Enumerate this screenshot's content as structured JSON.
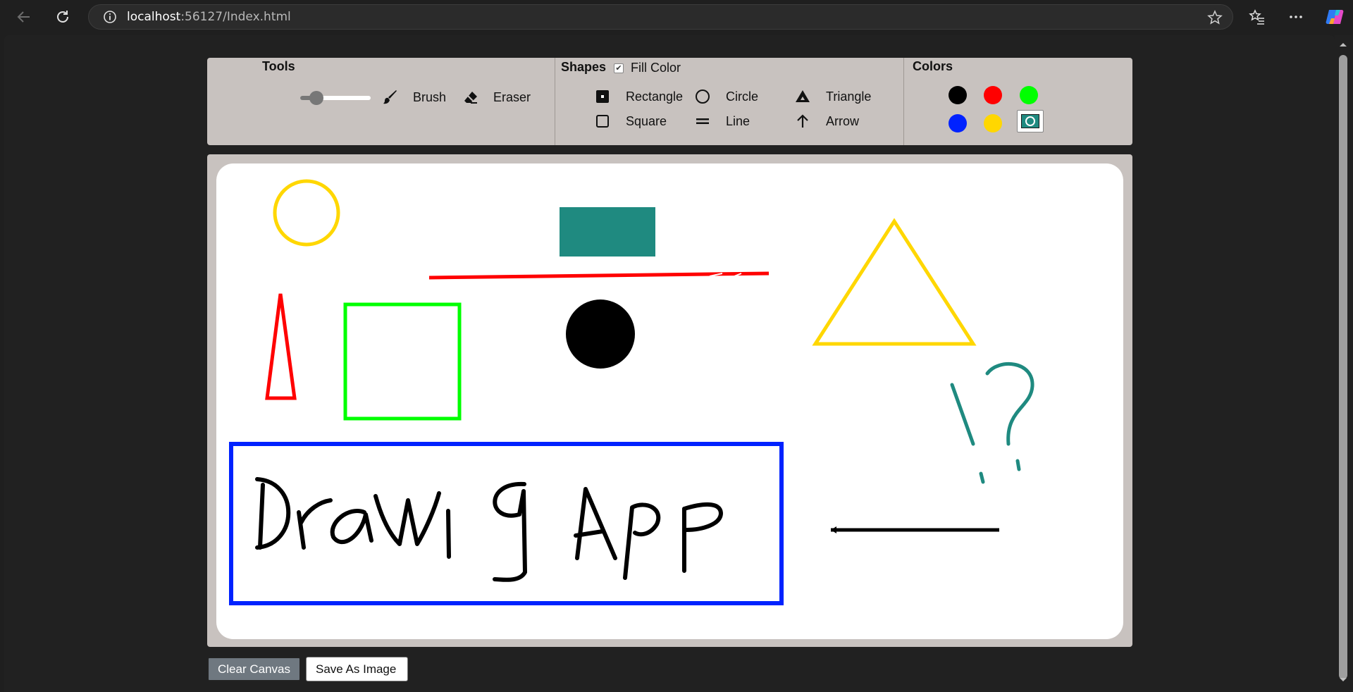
{
  "browser": {
    "url_host": "localhost",
    "url_rest": ":56127/Index.html"
  },
  "toolbar": {
    "tools": {
      "title": "Tools",
      "brush_size": 0.2,
      "brush_label": "Brush",
      "eraser_label": "Eraser"
    },
    "shapes": {
      "title": "Shapes",
      "fill_color_label": "Fill Color",
      "fill_color_checked": true,
      "items": [
        {
          "label": "Rectangle",
          "icon": "filled-square-icon"
        },
        {
          "label": "Circle",
          "icon": "circle-icon"
        },
        {
          "label": "Triangle",
          "icon": "triangle-icon"
        },
        {
          "label": "Square",
          "icon": "square-icon"
        },
        {
          "label": "Line",
          "icon": "line-icon"
        },
        {
          "label": "Arrow",
          "icon": "arrow-up-icon"
        }
      ]
    },
    "colors": {
      "title": "Colors",
      "swatches": [
        "#000000",
        "#ff0000",
        "#00ff00",
        "#0022ff",
        "#ffd700"
      ],
      "custom_color": "#1f8a80"
    }
  },
  "canvas": {
    "drawn_text": "Drawig App",
    "drawn_marks": "?",
    "stroke_colors": {
      "yellow": "#ffd700",
      "teal": "#1f8a80",
      "red": "#ff0000",
      "green": "#00ff00",
      "blue": "#0022ff",
      "black": "#000000"
    }
  },
  "buttons": {
    "clear_label": "Clear Canvas",
    "save_label": "Save As Image"
  }
}
